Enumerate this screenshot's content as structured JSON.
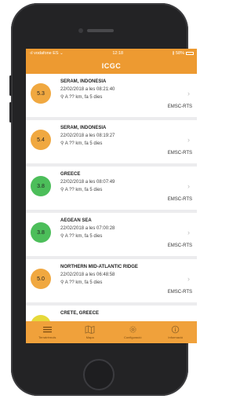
{
  "status_bar": {
    "carrier": "·ıl vodafone ES  ⌄",
    "time": "12:18",
    "battery": "∦ 58%"
  },
  "navbar": {
    "title": "ICGC"
  },
  "events": [
    {
      "magnitude": "5.3",
      "place": "SERAM, INDONESIA",
      "datetime": "22/02/2018 a les 08:21:40",
      "location": "A ?? km, fa 5 dies",
      "source": "EMSC-RTS",
      "color": "#f0a840"
    },
    {
      "magnitude": "5.4",
      "place": "SERAM, INDONESIA",
      "datetime": "22/02/2018 a les 08:19:27",
      "location": "A ?? km, fa 5 dies",
      "source": "EMSC-RTS",
      "color": "#f0a840"
    },
    {
      "magnitude": "3.8",
      "place": "GREECE",
      "datetime": "22/02/2018 a les 08:07:49",
      "location": "A ?? km, fa 5 dies",
      "source": "EMSC-RTS",
      "color": "#4cbe5a"
    },
    {
      "magnitude": "3.8",
      "place": "AEGEAN SEA",
      "datetime": "22/02/2018 a les 07:00:28",
      "location": "A ?? km, fa 5 dies",
      "source": "EMSC-RTS",
      "color": "#4cbe5a"
    },
    {
      "magnitude": "5.0",
      "place": "NORTHERN MID-ATLANTIC RIDGE",
      "datetime": "22/02/2018 a les 06:48:58",
      "location": "A ?? km, fa 5 dies",
      "source": "EMSC-RTS",
      "color": "#f0a840"
    },
    {
      "magnitude": "",
      "place": "CRETE, GREECE",
      "datetime": "",
      "location": "",
      "source": "",
      "color": "#e6d93a"
    }
  ],
  "tabs": [
    {
      "label": "Terratrèmols",
      "icon": "list-icon"
    },
    {
      "label": "Mapa",
      "icon": "map-icon"
    },
    {
      "label": "Configuració",
      "icon": "gear-icon"
    },
    {
      "label": "Informació",
      "icon": "info-icon"
    }
  ]
}
